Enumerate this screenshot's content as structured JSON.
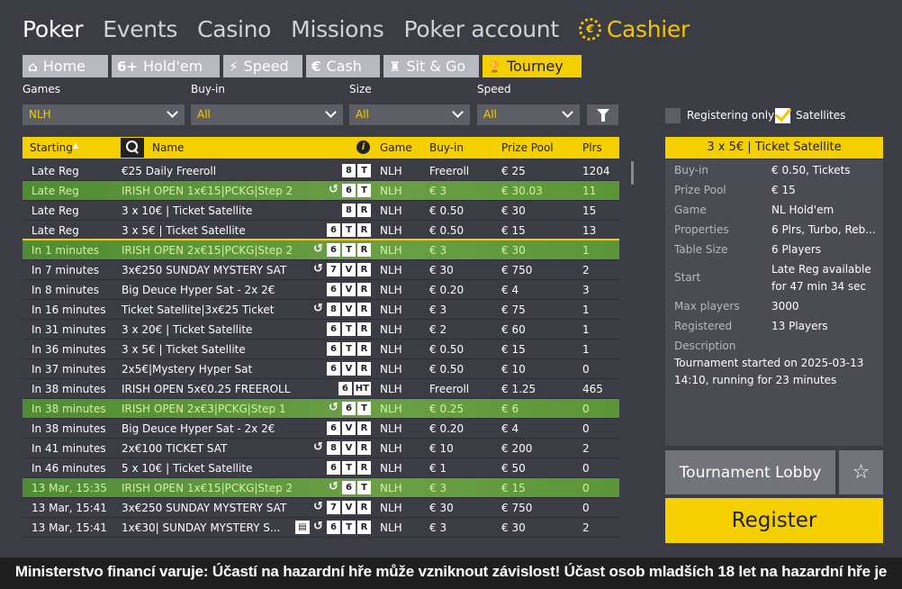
{
  "nav": {
    "items": [
      "Poker",
      "Events",
      "Casino",
      "Missions",
      "Poker account"
    ],
    "cashier": "Cashier",
    "cashier_icon": "euro-coin-icon"
  },
  "tabs": [
    {
      "icon": "⌂",
      "label": "Home"
    },
    {
      "icon": "6+",
      "label": "Hold'em"
    },
    {
      "icon": "⚡",
      "label": "Speed"
    },
    {
      "icon": "€",
      "label": "Cash"
    },
    {
      "icon": "♜",
      "label": "Sit & Go"
    },
    {
      "icon": "🏆",
      "label": "Tourney"
    }
  ],
  "filters": {
    "games_label": "Games",
    "games_value": "NLH",
    "buyin_label": "Buy-in",
    "buyin_value": "All",
    "size_label": "Size",
    "size_value": "All",
    "speed_label": "Speed",
    "speed_value": "All",
    "registering_only": "Registering only",
    "satellites": "Satellites"
  },
  "table": {
    "headers": {
      "starting": "Starting",
      "name": "Name",
      "game": "Game",
      "buyin": "Buy-in",
      "prize": "Prize Pool",
      "plrs": "Plrs"
    },
    "rows": [
      {
        "start": "Late Reg",
        "name": "€25 Daily Freeroll",
        "badges": [
          "8",
          "T"
        ],
        "game": "NLH",
        "buyin": "Freeroll",
        "prize": "€ 25",
        "plrs": "1204",
        "green": false
      },
      {
        "start": "Late Reg",
        "name": "IRISH OPEN 1x€15|PCKG|Step 2",
        "badges": [
          "↺",
          "6",
          "T"
        ],
        "game": "NLH",
        "buyin": "€ 3",
        "prize": "€ 30.03",
        "plrs": "11",
        "green": true
      },
      {
        "start": "Late Reg",
        "name": "3 x 10€ | Ticket Satellite",
        "badges": [
          "8",
          "R"
        ],
        "game": "NLH",
        "buyin": "€ 0.50",
        "prize": "€ 30",
        "plrs": "15",
        "green": false
      },
      {
        "start": "Late Reg",
        "name": "3 x 5€ | Ticket Satellite",
        "badges": [
          "6",
          "T",
          "R"
        ],
        "game": "NLH",
        "buyin": "€ 0.50",
        "prize": "€ 15",
        "plrs": "13",
        "green": false,
        "sep": true
      },
      {
        "start": "In 1 minutes",
        "name": "IRISH OPEN 2x€15|PCKG|Step 2",
        "badges": [
          "↺",
          "6",
          "T",
          "R"
        ],
        "game": "NLH",
        "buyin": "€ 3",
        "prize": "€ 30",
        "plrs": "1",
        "green": true
      },
      {
        "start": "In 7 minutes",
        "name": "3x€250 SUNDAY MYSTERY SAT",
        "badges": [
          "↺",
          "7",
          "V",
          "R"
        ],
        "game": "NLH",
        "buyin": "€ 30",
        "prize": "€ 750",
        "plrs": "2",
        "green": false
      },
      {
        "start": "In 8 minutes",
        "name": "Big Deuce Hyper Sat - 2x 2€",
        "badges": [
          "6",
          "V",
          "R"
        ],
        "game": "NLH",
        "buyin": "€ 0.20",
        "prize": "€ 4",
        "plrs": "3",
        "green": false
      },
      {
        "start": "In 16 minutes",
        "name": "Ticket Satellite|3x€25 Ticket",
        "badges": [
          "↺",
          "8",
          "V",
          "R"
        ],
        "game": "NLH",
        "buyin": "€ 3",
        "prize": "€ 75",
        "plrs": "1",
        "green": false
      },
      {
        "start": "In 31 minutes",
        "name": "3 x 20€ | Ticket Satellite",
        "badges": [
          "6",
          "T",
          "R"
        ],
        "game": "NLH",
        "buyin": "€ 2",
        "prize": "€ 60",
        "plrs": "1",
        "green": false
      },
      {
        "start": "In 36 minutes",
        "name": "3 x 5€ | Ticket Satellite",
        "badges": [
          "6",
          "T",
          "R"
        ],
        "game": "NLH",
        "buyin": "€ 0.50",
        "prize": "€ 15",
        "plrs": "1",
        "green": false
      },
      {
        "start": "In 37 minutes",
        "name": "2x5€|Mystery Hyper Sat",
        "badges": [
          "6",
          "V",
          "R"
        ],
        "game": "NLH",
        "buyin": "€ 0.50",
        "prize": "€ 10",
        "plrs": "0",
        "green": false
      },
      {
        "start": "In 38 minutes",
        "name": "IRISH OPEN 5x€0.25 FREEROLL",
        "badges": [
          "6",
          "HT"
        ],
        "game": "NLH",
        "buyin": "Freeroll",
        "prize": "€ 1.25",
        "plrs": "465",
        "green": false
      },
      {
        "start": "In 38 minutes",
        "name": "IRISH OPEN 2x€3|PCKG|Step 1",
        "badges": [
          "↺",
          "6",
          "T"
        ],
        "game": "NLH",
        "buyin": "€ 0.25",
        "prize": "€ 6",
        "plrs": "0",
        "green": true
      },
      {
        "start": "In 38 minutes",
        "name": "Big Deuce Hyper Sat - 2x 2€",
        "badges": [
          "6",
          "V",
          "R"
        ],
        "game": "NLH",
        "buyin": "€ 0.20",
        "prize": "€ 4",
        "plrs": "0",
        "green": false
      },
      {
        "start": "In 41 minutes",
        "name": "2x€100 TICKET SAT",
        "badges": [
          "↺",
          "8",
          "V",
          "R"
        ],
        "game": "NLH",
        "buyin": "€ 10",
        "prize": "€ 200",
        "plrs": "2",
        "green": false
      },
      {
        "start": "In 46 minutes",
        "name": "5 x 10€ | Ticket Satellite",
        "badges": [
          "6",
          "T",
          "R"
        ],
        "game": "NLH",
        "buyin": "€ 1",
        "prize": "€ 50",
        "plrs": "0",
        "green": false
      },
      {
        "start": "13 Mar, 15:35",
        "name": "IRISH OPEN 1x€15|PCKG|Step 2",
        "badges": [
          "↺",
          "6",
          "T"
        ],
        "game": "NLH",
        "buyin": "€ 3",
        "prize": "€ 15",
        "plrs": "0",
        "green": true
      },
      {
        "start": "13 Mar, 15:41",
        "name": "3x€250 SUNDAY MYSTERY SAT",
        "badges": [
          "↺",
          "7",
          "V",
          "R"
        ],
        "game": "NLH",
        "buyin": "€ 30",
        "prize": "€ 750",
        "plrs": "0",
        "green": false
      },
      {
        "start": "13 Mar, 15:41",
        "name": "1x€30| SUNDAY MYSTERY S...",
        "badges": [
          "▤",
          "↺",
          "6",
          "T",
          "R"
        ],
        "game": "NLH",
        "buyin": "€ 3",
        "prize": "€ 30",
        "plrs": "2",
        "green": false
      }
    ]
  },
  "panel": {
    "title": "3 x 5€ | Ticket Satellite",
    "buyin_k": "Buy-in",
    "buyin_v": "€ 0.50, Tickets",
    "prize_k": "Prize Pool",
    "prize_v": "€ 15",
    "game_k": "Game",
    "game_v": "NL Hold'em",
    "props_k": "Properties",
    "props_v": "6 Plrs, Turbo, Reb...",
    "table_k": "Table Size",
    "table_v": "6 Players",
    "start_k": "Start",
    "start_v1": "Late Reg available",
    "start_v2": "for 47 min 34 sec",
    "max_k": "Max players",
    "max_v": "3000",
    "reg_k": "Registered",
    "reg_v": "13 Players",
    "desc_k": "Description",
    "desc_v": "Tournament started on 2025-03-13 14:10, running for 23 minutes",
    "lobby": "Tournament Lobby",
    "star_icon": "☆",
    "register": "Register"
  },
  "warning": "Ministerstvo financí varuje: Účastí na hazardní hře může vzniknout závislost! Účast osob mladších 18 let na hazardní hře je zakázána!"
}
